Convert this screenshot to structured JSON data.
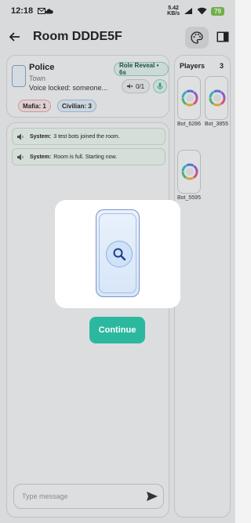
{
  "status_bar": {
    "time": "12:18",
    "speed_value": "5.42",
    "speed_unit": "KB/s",
    "battery": "79"
  },
  "header": {
    "title": "Room DDDE5F"
  },
  "role_card": {
    "name": "Police",
    "team": "Town",
    "voice_status": "Voice locked: someone...",
    "phase": "Role Reveal • 6s",
    "speaker_count": "0/1",
    "mafia_count": "Mafia: 1",
    "civilian_count": "Civilian: 3"
  },
  "chat": {
    "messages": [
      {
        "sender": "System:",
        "text": "3 test bots joined the room."
      },
      {
        "sender": "System:",
        "text": "Room is full. Starting now."
      }
    ],
    "input_placeholder": "Type message"
  },
  "players": {
    "title": "Players",
    "count": "3",
    "list": [
      {
        "name": "Bot_6286"
      },
      {
        "name": "Bot_3855"
      },
      {
        "name": "Bot_5595"
      }
    ]
  },
  "modal": {
    "continue_label": "Continue",
    "icon": "search-icon"
  },
  "colors": {
    "accent": "#2bb89f",
    "mafia": "#e3a9a9",
    "civilian": "#a9c3e0"
  }
}
